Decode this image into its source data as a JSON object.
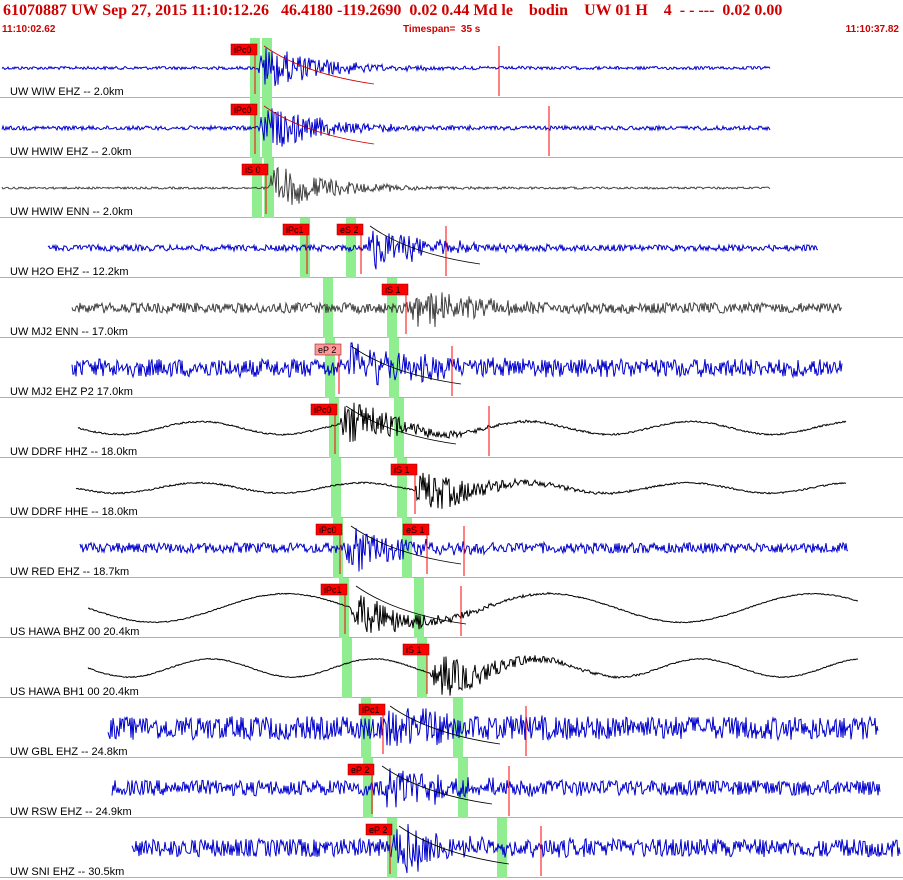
{
  "header": {
    "title": "61070887 UW Sep 27, 2015 11:10:12.26   46.4180 -119.2690  0.02 0.44 Md le    bodin    UW 01 H    4  - - ---  0.02 0.00",
    "time_start": "11:10:02.62",
    "timespan": "Timespan=  35 s",
    "time_end": "11:10:37.82"
  },
  "colors": {
    "header_text": "#d00000",
    "trace_blue": "#0000cc",
    "trace_gray": "#404040",
    "trace_black": "#000000",
    "pick_flag": "#ff0000",
    "pick_flag_emergent": "#ff9999",
    "pick_window": "#90ee90",
    "coda_line": "#000000",
    "separator": "#b0b0b0"
  },
  "traces": [
    {
      "label": "UW WIW EHZ -- 2.0km",
      "color": "trace_blue",
      "noise": 0.06,
      "long_period": 0,
      "picks": [
        {
          "label": "iPc0",
          "emergent": false
        }
      ],
      "coda": true
    },
    {
      "label": "UW HWIW EHZ -- 2.0km",
      "color": "trace_blue",
      "noise": 0.08,
      "long_period": 0,
      "picks": [
        {
          "label": "iPc0",
          "emergent": false
        }
      ],
      "coda": true
    },
    {
      "label": "UW HWIW ENN -- 2.0km",
      "color": "trace_gray",
      "noise": 0.04,
      "long_period": 0,
      "picks": [
        {
          "label": "iS 0",
          "emergent": false
        }
      ],
      "coda": false
    },
    {
      "label": "UW H2O EHZ -- 12.2km",
      "color": "trace_blue",
      "noise": 0.12,
      "long_period": 0,
      "picks": [
        {
          "label": "iPc1",
          "emergent": false
        },
        {
          "label": "eS 2",
          "emergent": false
        }
      ],
      "coda": true
    },
    {
      "label": "UW MJ2 ENN -- 17.0km",
      "color": "trace_gray",
      "noise": 0.2,
      "long_period": 0,
      "picks": [
        {
          "label": "iS 1",
          "emergent": false
        }
      ],
      "coda": false
    },
    {
      "label": "UW MJ2 EHZ P2 17.0km",
      "color": "trace_blue",
      "noise": 0.35,
      "long_period": 0,
      "picks": [
        {
          "label": "eP 2",
          "emergent": true
        }
      ],
      "coda": true
    },
    {
      "label": "UW DDRF HHZ -- 18.0km",
      "color": "trace_black",
      "noise": 0.03,
      "long_period": 0.25,
      "picks": [
        {
          "label": "iPc0",
          "emergent": false
        }
      ],
      "coda": true
    },
    {
      "label": "UW DDRF HHE -- 18.0km",
      "color": "trace_black",
      "noise": 0.03,
      "long_period": 0.2,
      "picks": [
        {
          "label": "iS 1",
          "emergent": false
        }
      ],
      "coda": false
    },
    {
      "label": "UW RED EHZ -- 18.7km",
      "color": "trace_blue",
      "noise": 0.2,
      "long_period": 0,
      "picks": [
        {
          "label": "iPc0",
          "emergent": false
        },
        {
          "label": "eS 1",
          "emergent": false
        }
      ],
      "coda": true
    },
    {
      "label": "US HAWA BHZ 00 20.4km",
      "color": "trace_black",
      "noise": 0.02,
      "long_period": 0.55,
      "picks": [
        {
          "label": "iPc1",
          "emergent": false
        }
      ],
      "coda": true
    },
    {
      "label": "US HAWA BH1 00 20.4km",
      "color": "trace_black",
      "noise": 0.02,
      "long_period": 0.35,
      "picks": [
        {
          "label": "iS 1",
          "emergent": false
        }
      ],
      "coda": false
    },
    {
      "label": "UW GBL EHZ -- 24.8km",
      "color": "trace_blue",
      "noise": 0.45,
      "long_period": 0,
      "picks": [
        {
          "label": "iPc1",
          "emergent": false
        }
      ],
      "coda": true
    },
    {
      "label": "UW RSW EHZ -- 24.9km",
      "color": "trace_blue",
      "noise": 0.3,
      "long_period": 0,
      "picks": [
        {
          "label": "eP 2",
          "emergent": false
        }
      ],
      "coda": true
    },
    {
      "label": "UW SNI EHZ -- 30.5km",
      "color": "trace_blue",
      "noise": 0.35,
      "long_period": 0,
      "picks": [
        {
          "label": "eP 2",
          "emergent": false
        }
      ],
      "coda": true
    }
  ]
}
